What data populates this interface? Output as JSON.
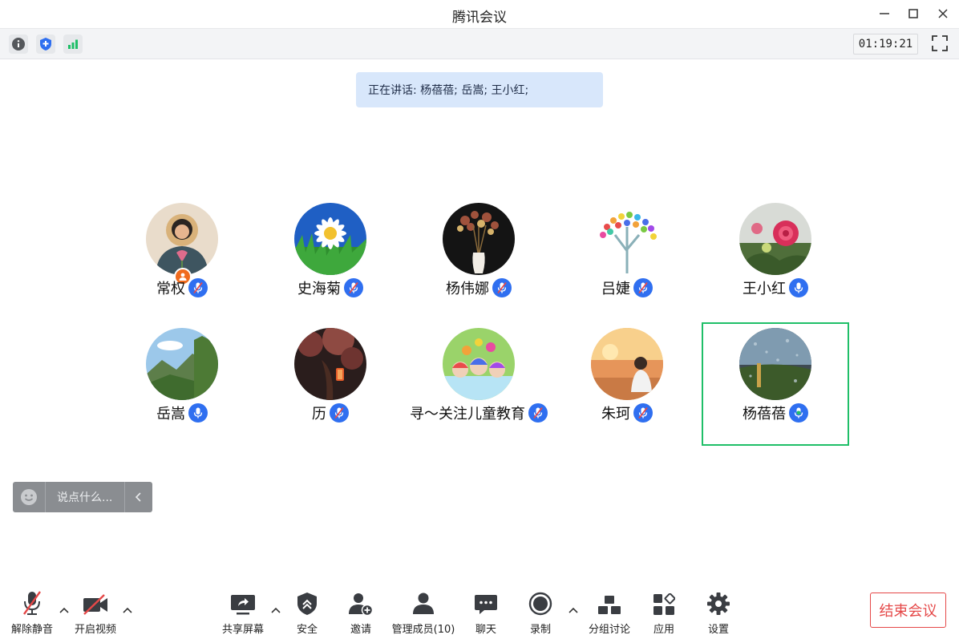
{
  "window": {
    "title": "腾讯会议"
  },
  "toolbar": {
    "timer": "01:19:21"
  },
  "speaking": {
    "text": "正在讲话: 杨蓓蓓; 岳嵩; 王小红;"
  },
  "participants": [
    {
      "name": "常权",
      "host": true,
      "muted": true,
      "avatar": "woman-with-flower-portrait"
    },
    {
      "name": "史海菊",
      "muted": true,
      "avatar": "daisy-flower"
    },
    {
      "name": "杨伟娜",
      "muted": true,
      "avatar": "dried-flowers-vase"
    },
    {
      "name": "吕婕",
      "muted": true,
      "avatar": "colorful-tree"
    },
    {
      "name": "王小红",
      "muted": false,
      "avatar": "rose-garden"
    },
    {
      "name": "岳嵩",
      "muted": false,
      "avatar": "mountain-landscape"
    },
    {
      "name": "历",
      "muted": true,
      "avatar": "night-lantern-tree"
    },
    {
      "name": "寻～关注儿童教育",
      "muted": true,
      "avatar": "cartoon-dolls"
    },
    {
      "name": "朱珂",
      "muted": true,
      "avatar": "girl-sunset-beach"
    },
    {
      "name": "杨蓓蓓",
      "muted": false,
      "speaking": true,
      "avatar": "rainy-window"
    }
  ],
  "chat": {
    "placeholder": "说点什么..."
  },
  "bottombar": {
    "unmute": "解除静音",
    "start_video": "开启视频",
    "share_screen": "共享屏幕",
    "security": "安全",
    "invite": "邀请",
    "manage_members": "管理成员(10)",
    "chat": "聊天",
    "record": "录制",
    "breakout": "分组讨论",
    "apps": "应用",
    "settings": "设置",
    "end_meeting": "结束会议"
  },
  "colors": {
    "accent": "#2f6ff0",
    "speaking_border": "#1fbf68",
    "end": "#e54848",
    "host_badge": "#f06b1e"
  }
}
